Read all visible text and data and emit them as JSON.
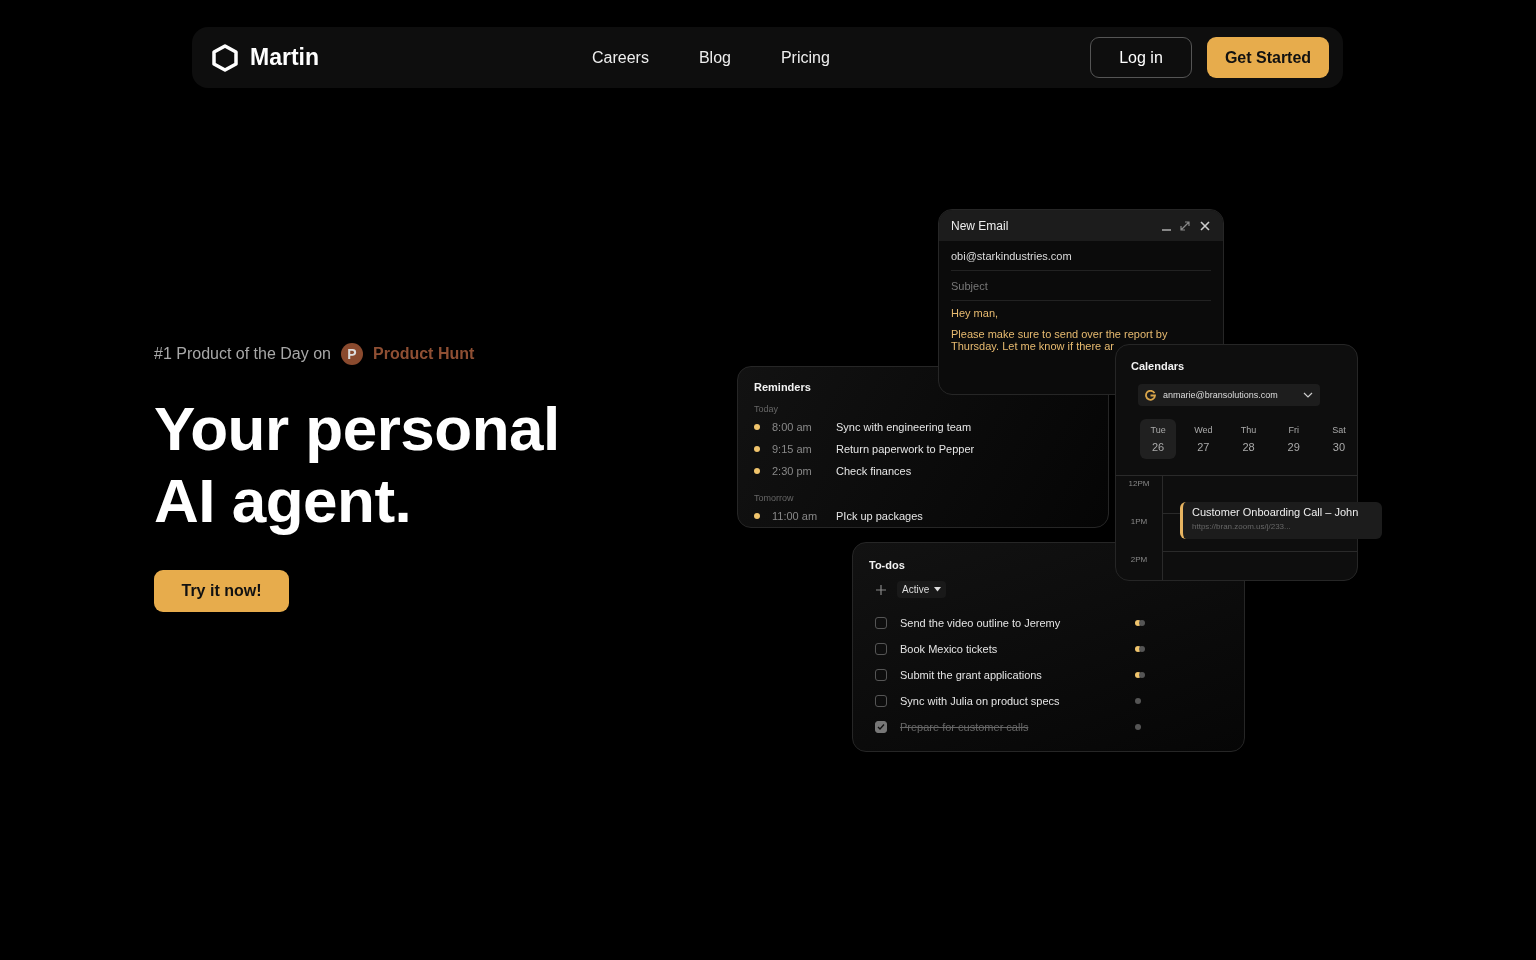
{
  "nav": {
    "brand": "Martin",
    "links": [
      "Careers",
      "Blog",
      "Pricing"
    ],
    "login": "Log in",
    "cta": "Get Started"
  },
  "hero": {
    "badge_text": "#1 Product of the Day on",
    "badge_letter": "P",
    "badge_brand": "Product Hunt",
    "title_lines": [
      "Your personal",
      "AI agent."
    ],
    "button": "Try it now!"
  },
  "email": {
    "title": "New Email",
    "to": "obi@starkindustries.com",
    "subject_placeholder": "Subject",
    "greeting": "Hey man,",
    "body_lines": [
      "Please make sure to send over the report by",
      "Thursday. Let me know if there ar"
    ]
  },
  "reminders": {
    "title": "Reminders",
    "groups": [
      {
        "label": "Today",
        "items": [
          {
            "time": "8:00 am",
            "text": "Sync with engineering team"
          },
          {
            "time": "9:15 am",
            "text": "Return paperwork to Pepper"
          },
          {
            "time": "2:30 pm",
            "text": "Check finances"
          }
        ]
      },
      {
        "label": "Tomorrow",
        "items": [
          {
            "time": "11:00 am",
            "text": "PIck up packages"
          }
        ]
      }
    ]
  },
  "calendars": {
    "title": "Calendars",
    "account": "anmarie@bransolutions.com",
    "days": [
      {
        "day": "Tue",
        "date": "26",
        "selected": true
      },
      {
        "day": "Wed",
        "date": "27",
        "selected": false
      },
      {
        "day": "Thu",
        "date": "28",
        "selected": false
      },
      {
        "day": "Fri",
        "date": "29",
        "selected": false
      },
      {
        "day": "Sat",
        "date": "30",
        "selected": false
      }
    ],
    "hours": [
      "12PM",
      "1PM",
      "2PM"
    ],
    "event": {
      "title": "Customer Onboarding Call – John",
      "link": "https://bran.zoom.us/j/233..."
    }
  },
  "todos": {
    "title": "To-dos",
    "filter": "Active",
    "items": [
      {
        "text": "Send the video outline to Jeremy",
        "checked": false,
        "flagged": true
      },
      {
        "text": "Book Mexico tickets",
        "checked": false,
        "flagged": true
      },
      {
        "text": "Submit the grant applications",
        "checked": false,
        "flagged": true
      },
      {
        "text": "Sync with Julia on product specs",
        "checked": false,
        "flagged": false
      },
      {
        "text": "Prepare for customer calls",
        "checked": true,
        "flagged": false
      }
    ]
  }
}
